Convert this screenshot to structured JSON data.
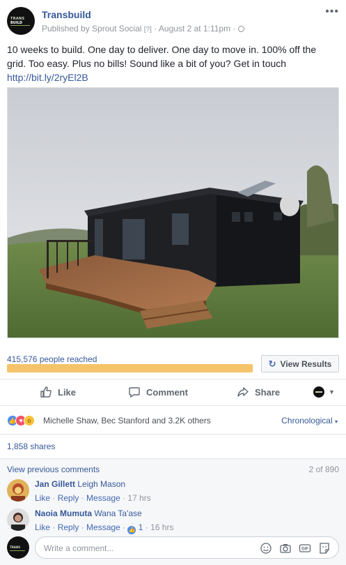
{
  "post": {
    "page_name": "Transbuild",
    "published_by": "Published by Sprout Social",
    "help": "[?]",
    "date": "August 2 at 1:11pm",
    "text": "10 weeks to build. One day to deliver. One day to move in. 100% off the grid. Too easy. Plus no bills! Sound like a bit of you? Get in touch",
    "link": "http://bit.ly/2ryEl2B",
    "logo_top": "TRANS",
    "logo_bottom": "BUILD"
  },
  "insights": {
    "reach_text": "415,576 people reached",
    "reach_fill": 1.0,
    "view_results_label": "View Results"
  },
  "actions": {
    "like": "Like",
    "comment": "Comment",
    "share": "Share"
  },
  "reactions": {
    "names": "Michelle Shaw, Bec Stanford and 3.2K others",
    "sort": "Chronological"
  },
  "shares": "1,858 shares",
  "comments": {
    "view_previous": "View previous comments",
    "count": "2 of 890",
    "items": [
      {
        "name": "Jan Gillett",
        "tag": "Leigh Mason",
        "meta_like": "Like",
        "meta_reply": "Reply",
        "meta_message": "Message",
        "time": "17 hrs"
      },
      {
        "name": "Naoia Mumuta",
        "tag": "Wana Ta'ase",
        "meta_like": "Like",
        "meta_reply": "Reply",
        "meta_message": "Message",
        "likes": "1",
        "time": "16 hrs"
      }
    ],
    "placeholder": "Write a comment..."
  },
  "colors": {
    "link": "#365899",
    "reach_bar": "#f7c66e",
    "text": "#1d2129",
    "muted": "#90949c"
  },
  "icons": [
    "more-dots-icon",
    "globe-icon",
    "refresh-icon",
    "thumbs-up-icon",
    "speech-bubble-icon",
    "share-arrow-icon",
    "emoji-icon",
    "camera-icon",
    "gif-icon",
    "sticker-icon"
  ]
}
